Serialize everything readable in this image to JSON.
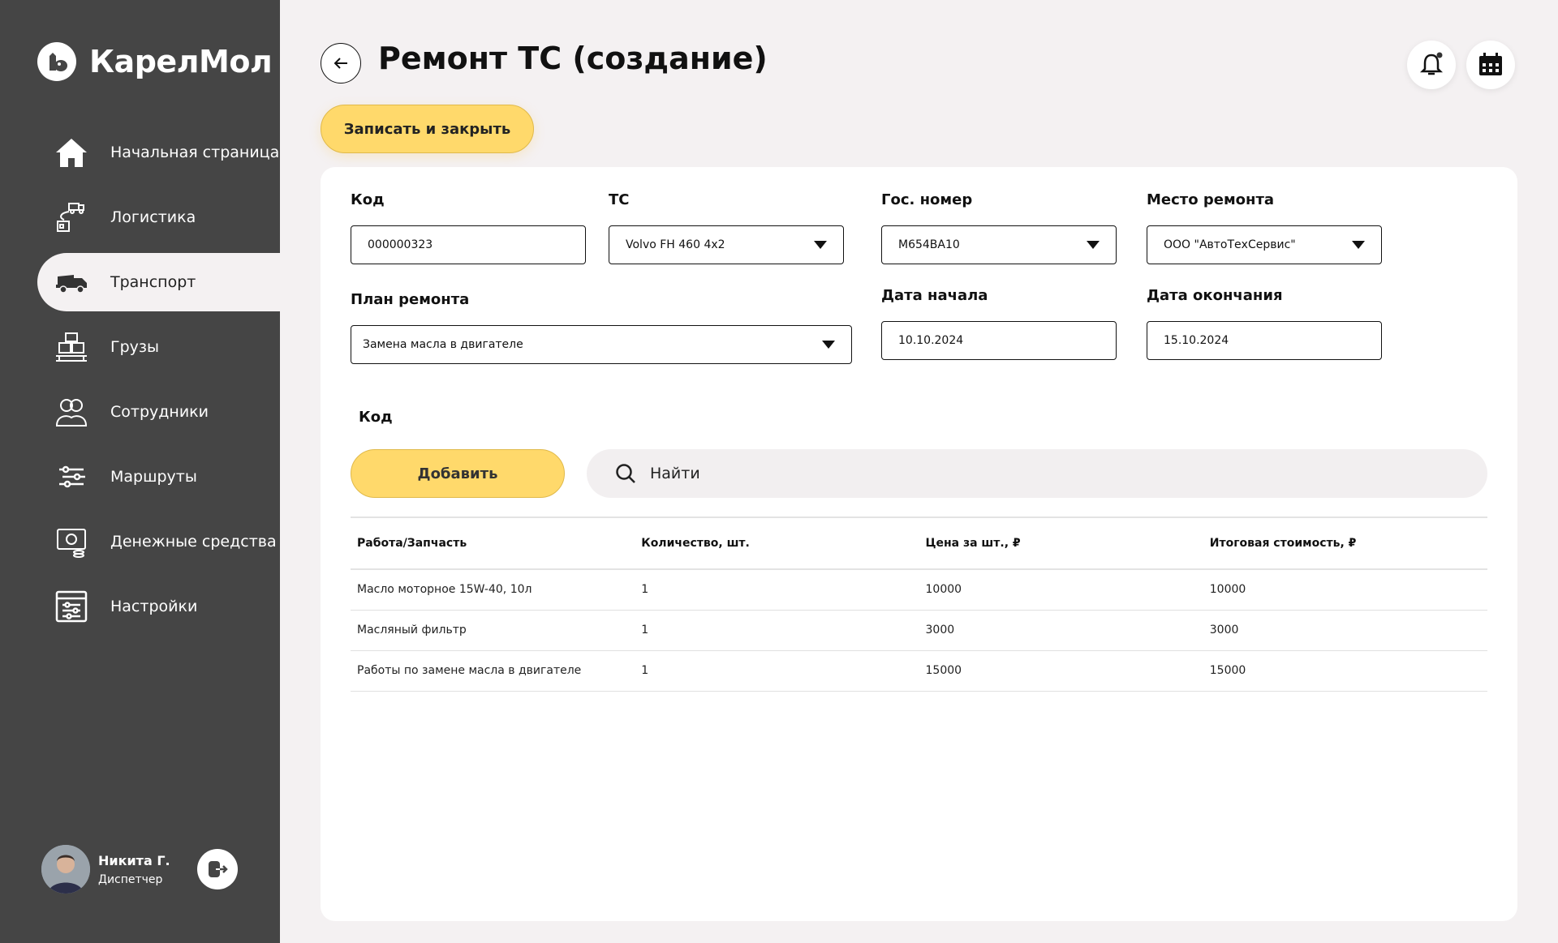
{
  "app": {
    "name": "КарелМол"
  },
  "sidebar": {
    "items": [
      {
        "label": "Начальная страница",
        "icon": "home-icon",
        "active": false
      },
      {
        "label": "Логистика",
        "icon": "logistics-icon",
        "active": false
      },
      {
        "label": "Транспорт",
        "icon": "truck-icon",
        "active": true
      },
      {
        "label": "Грузы",
        "icon": "cargo-icon",
        "active": false
      },
      {
        "label": "Сотрудники",
        "icon": "employees-icon",
        "active": false
      },
      {
        "label": "Маршруты",
        "icon": "routes-icon",
        "active": false
      },
      {
        "label": "Денежные средства",
        "icon": "money-icon",
        "active": false
      },
      {
        "label": "Настройки",
        "icon": "settings-icon",
        "active": false
      }
    ]
  },
  "user": {
    "name": "Никита Г.",
    "role": "Диспетчер"
  },
  "header": {
    "title": "Ремонт ТС (создание)",
    "save_label": "Записать и закрыть"
  },
  "form": {
    "code_label": "Код",
    "code_value": "000000323",
    "vehicle_label": "ТС",
    "vehicle_value": "Volvo FH 460 4x2",
    "plate_label": "Гос. номер",
    "plate_value": "М654ВА10",
    "place_label": "Место ремонта",
    "place_value": "ООО \"АвтоТехСервис\"",
    "plan_label": "План ремонта",
    "plan_value": "Замена масла в двигателе",
    "start_label": "Дата начала",
    "start_value": "10.10.2024",
    "end_label": "Дата окончания",
    "end_value": "15.10.2024"
  },
  "items_section": {
    "title": "Код",
    "add_label": "Добавить",
    "search_placeholder": "Найти",
    "columns": [
      "Работа/Запчасть",
      "Количество, шт.",
      "Цена за шт., ₽",
      "Итоговая стоимость, ₽"
    ],
    "rows": [
      [
        "Масло моторное 15W-40, 10л",
        "1",
        "10000",
        "10000"
      ],
      [
        "Масляный фильтр",
        "1",
        "3000",
        "3000"
      ],
      [
        "Работы по замене масла в двигателе",
        "1",
        "15000",
        "15000"
      ]
    ]
  },
  "colors": {
    "sidebar": "#454545",
    "accent": "#ffd96b",
    "background": "#f4f1f2"
  }
}
